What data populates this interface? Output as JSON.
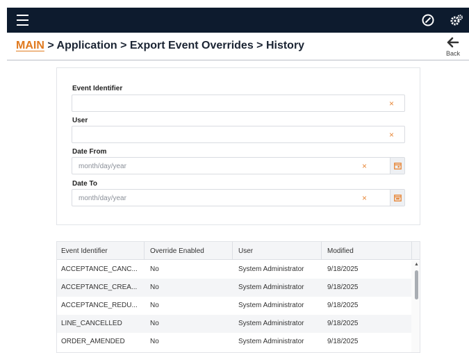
{
  "header": {
    "menu_icon": "hamburger-icon",
    "compass_icon": "compass-icon",
    "settings_icon": "gears-icon"
  },
  "breadcrumb": {
    "main": "MAIN",
    "rest": " > Application > Export Event Overrides > History"
  },
  "back": {
    "label": "Back",
    "icon": "arrow-left-icon"
  },
  "filters": {
    "event_identifier": {
      "label": "Event Identifier",
      "value": ""
    },
    "user": {
      "label": "User",
      "value": ""
    },
    "date_from": {
      "label": "Date From",
      "placeholder": "month/day/year"
    },
    "date_to": {
      "label": "Date To",
      "placeholder": "month/day/year"
    },
    "clear_glyph": "×"
  },
  "table": {
    "columns": [
      "Event Identifier",
      "Override Enabled",
      "User",
      "Modified"
    ],
    "rows": [
      [
        "ACCEPTANCE_CANC...",
        "No",
        "System Administrator",
        "9/18/2025"
      ],
      [
        "ACCEPTANCE_CREA...",
        "No",
        "System Administrator",
        "9/18/2025"
      ],
      [
        "ACCEPTANCE_REDU...",
        "No",
        "System Administrator",
        "9/18/2025"
      ],
      [
        "LINE_CANCELLED",
        "No",
        "System Administrator",
        "9/18/2025"
      ],
      [
        "ORDER_AMENDED",
        "No",
        "System Administrator",
        "9/18/2025"
      ]
    ]
  },
  "colors": {
    "topbar": "#0d1b2e",
    "accent": "#e07a1f"
  }
}
